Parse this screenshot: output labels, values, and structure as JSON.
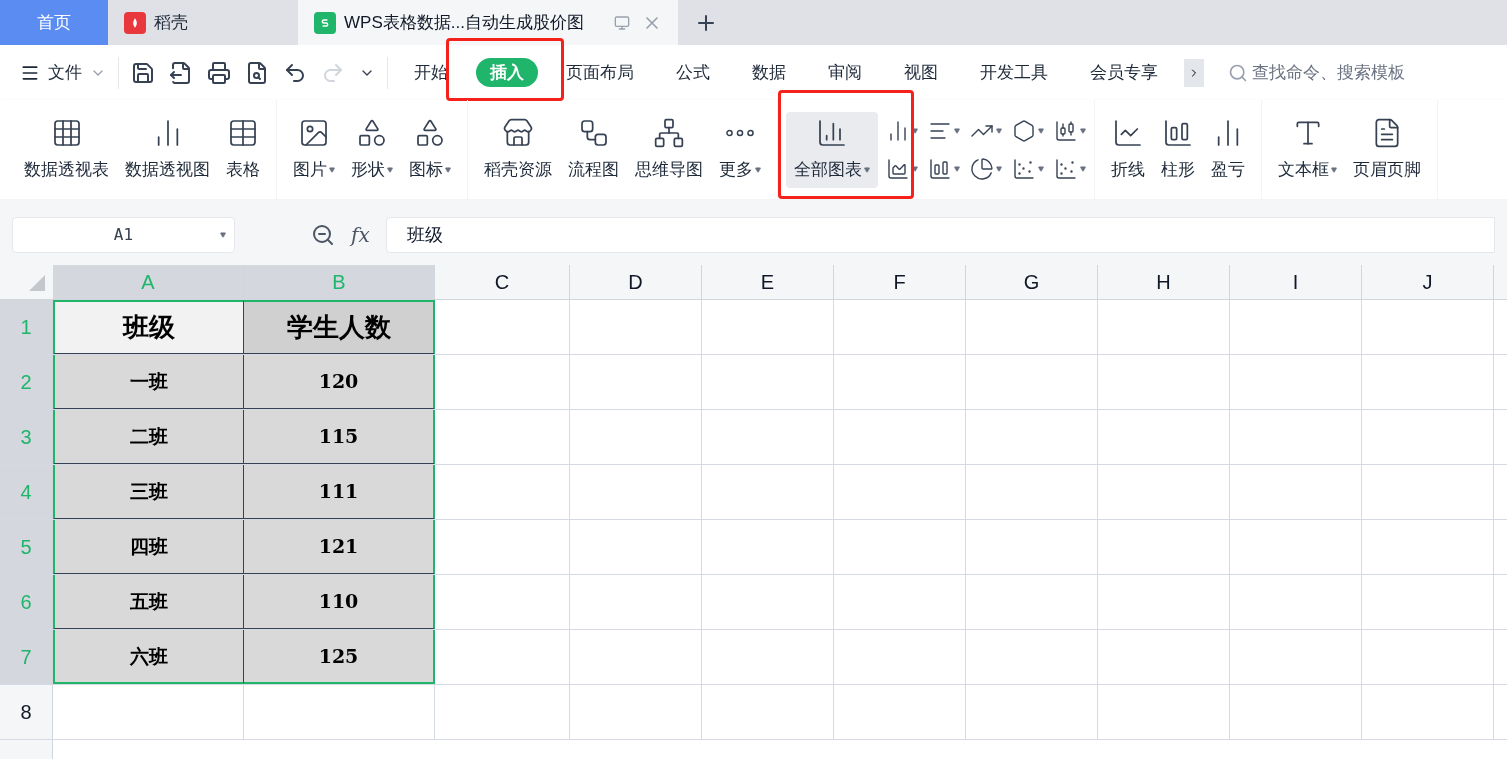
{
  "window_tabs": [
    {
      "label": "首页",
      "kind": "home",
      "selected": false
    },
    {
      "label": "稻壳",
      "kind": "docer",
      "selected": false
    },
    {
      "label": "WPS表格数据...自动生成股价图",
      "kind": "document",
      "selected": true
    }
  ],
  "file_menu": {
    "label": "文件"
  },
  "ribbon_tabs": [
    {
      "label": "开始",
      "selected": false,
      "highlighted": false
    },
    {
      "label": "插入",
      "selected": true,
      "highlighted": true
    },
    {
      "label": "页面布局",
      "selected": false,
      "highlighted": false
    },
    {
      "label": "公式",
      "selected": false,
      "highlighted": false
    },
    {
      "label": "数据",
      "selected": false,
      "highlighted": false
    },
    {
      "label": "审阅",
      "selected": false,
      "highlighted": false
    },
    {
      "label": "视图",
      "selected": false,
      "highlighted": false
    },
    {
      "label": "开发工具",
      "selected": false,
      "highlighted": false
    },
    {
      "label": "会员专享",
      "selected": false,
      "highlighted": false
    }
  ],
  "search": {
    "placeholder": "查找命令、搜索模板"
  },
  "ribbon_groups": [
    {
      "items": [
        {
          "label": "数据透视表",
          "dropdown": false
        },
        {
          "label": "数据透视图",
          "dropdown": false
        },
        {
          "label": "表格",
          "dropdown": false
        }
      ]
    },
    {
      "items": [
        {
          "label": "图片",
          "dropdown": true
        },
        {
          "label": "形状",
          "dropdown": true
        },
        {
          "label": "图标",
          "dropdown": true
        }
      ]
    },
    {
      "items": [
        {
          "label": "稻壳资源",
          "dropdown": false
        },
        {
          "label": "流程图",
          "dropdown": false
        },
        {
          "label": "思维导图",
          "dropdown": false
        },
        {
          "label": "更多",
          "dropdown": true
        }
      ]
    },
    {
      "kind": "charts",
      "highlighted": true,
      "items": [
        {
          "label": "全部图表",
          "dropdown": true
        }
      ]
    },
    {
      "items": [
        {
          "label": "折线",
          "dropdown": false
        },
        {
          "label": "柱形",
          "dropdown": false
        },
        {
          "label": "盈亏",
          "dropdown": false
        }
      ]
    },
    {
      "items": [
        {
          "label": "文本框",
          "dropdown": true
        },
        {
          "label": "页眉页脚",
          "dropdown": false
        }
      ]
    }
  ],
  "formula_bar": {
    "name_box": "A1",
    "function_label": "fx",
    "formula": "班级"
  },
  "grid": {
    "columns": [
      {
        "label": "A",
        "selected": true
      },
      {
        "label": "B",
        "selected": true
      },
      {
        "label": "C",
        "selected": false
      },
      {
        "label": "D",
        "selected": false
      },
      {
        "label": "E",
        "selected": false
      },
      {
        "label": "F",
        "selected": false
      },
      {
        "label": "G",
        "selected": false
      },
      {
        "label": "H",
        "selected": false
      },
      {
        "label": "I",
        "selected": false
      },
      {
        "label": "J",
        "selected": false
      }
    ],
    "rows": [
      {
        "label": "1",
        "selected": true,
        "kind": "header",
        "cells": [
          "班级",
          "学生人数"
        ]
      },
      {
        "label": "2",
        "selected": true,
        "kind": "data",
        "cells": [
          "一班",
          "120"
        ]
      },
      {
        "label": "3",
        "selected": true,
        "kind": "data",
        "cells": [
          "二班",
          "115"
        ]
      },
      {
        "label": "4",
        "selected": true,
        "kind": "data",
        "cells": [
          "三班",
          "111"
        ]
      },
      {
        "label": "5",
        "selected": true,
        "kind": "data",
        "cells": [
          "四班",
          "121"
        ]
      },
      {
        "label": "6",
        "selected": true,
        "kind": "data",
        "cells": [
          "五班",
          "110"
        ]
      },
      {
        "label": "7",
        "selected": true,
        "kind": "data",
        "cells": [
          "六班",
          "125"
        ]
      },
      {
        "label": "8",
        "selected": false,
        "kind": "empty",
        "cells": []
      }
    ]
  }
}
